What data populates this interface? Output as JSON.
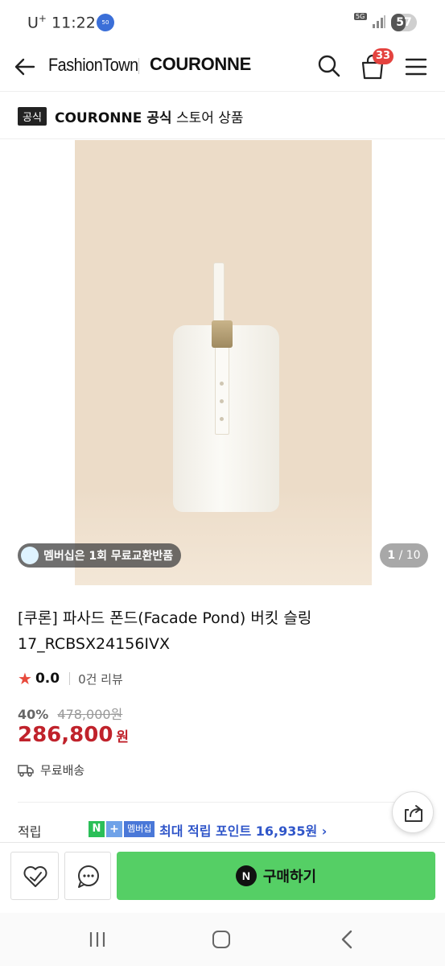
{
  "status_bar": {
    "carrier": "U",
    "carrier_sup": "+",
    "time": "11:22",
    "network": "5G",
    "battery_level": "57"
  },
  "header": {
    "logo": "FashionTown",
    "brand": "COURONNE",
    "cart_count": "33"
  },
  "official": {
    "badge": "공식",
    "brand_bold": "COURONNE 공식",
    "text": "스토어 상품"
  },
  "gallery": {
    "membership_chip": "멤버십은 1회 무료교환반품",
    "current_page": "1",
    "total_pages": "/ 10"
  },
  "product": {
    "title_line1": "[쿠론] 파사드 폰드(Facade Pond) 버킷 슬링",
    "title_line2": "17_RCBSX24156IVX",
    "rating": "0.0",
    "review_count": "0건 리뷰",
    "discount_rate": "40%",
    "original_price": "478,000원",
    "price": "286,800",
    "price_unit": "원",
    "shipping": "무료배송"
  },
  "points": {
    "label": "적립",
    "n_badge": "N",
    "plus_badge": "+",
    "member_badge": "멤버십",
    "text": "최대 적립 포인트 16,935원 ›"
  },
  "actions": {
    "buy_label": "구매하기",
    "buy_icon_letter": "N"
  },
  "colors": {
    "accent_price": "#c0222b",
    "buy_button": "#55cf65",
    "cart_badge": "#e4433f",
    "points_text": "#3056c9"
  }
}
